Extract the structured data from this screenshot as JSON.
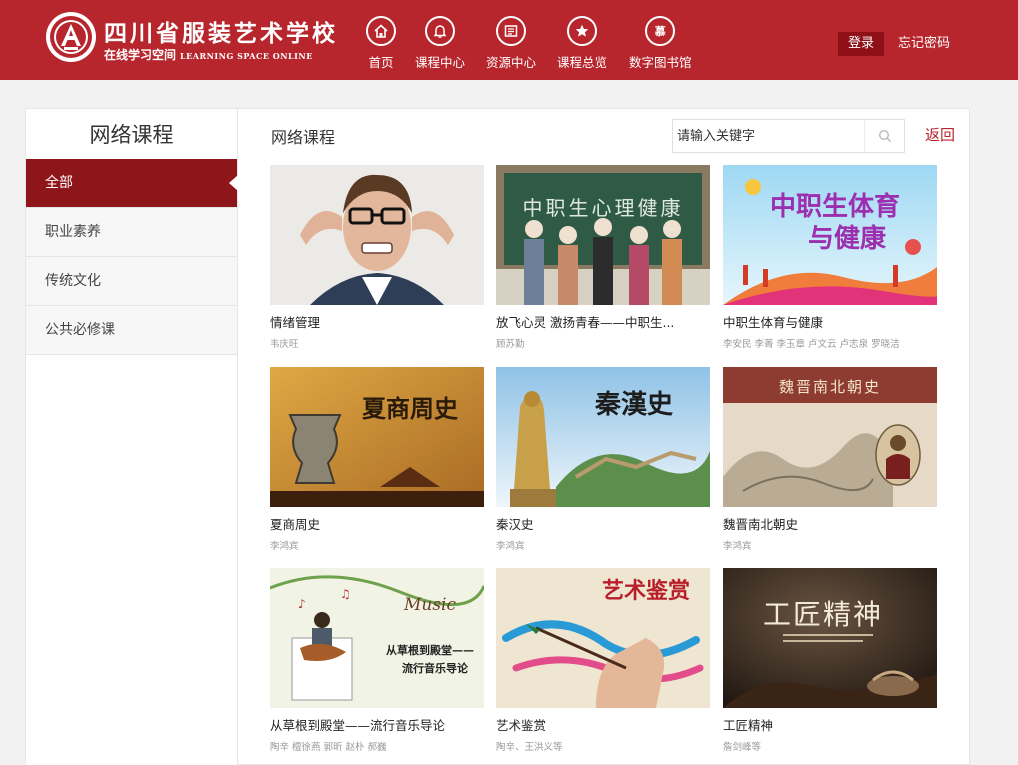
{
  "header": {
    "school_name": "四川省服装艺术学校",
    "subtitle_cn": "在线学习空间",
    "subtitle_en": "LEARNING SPACE ONLINE",
    "nav": [
      {
        "label": "首页",
        "icon": "home-icon"
      },
      {
        "label": "课程中心",
        "icon": "bell-icon"
      },
      {
        "label": "资源中心",
        "icon": "resource-icon"
      },
      {
        "label": "课程总览",
        "icon": "star-icon"
      },
      {
        "label": "数字图书馆",
        "icon": "mooc-icon",
        "glyph": "慕"
      }
    ],
    "login_label": "登录",
    "forgot_label": "忘记密码"
  },
  "sidebar": {
    "title": "网络课程",
    "items": [
      {
        "label": "全部",
        "active": true
      },
      {
        "label": "职业素养",
        "active": false
      },
      {
        "label": "传统文化",
        "active": false
      },
      {
        "label": "公共必修课",
        "active": false
      }
    ]
  },
  "main": {
    "title": "网络课程",
    "search_placeholder": "请输入关键字",
    "back_label": "返回",
    "courses": [
      {
        "title": "情绪管理",
        "author": "韦庆旺"
      },
      {
        "title": "放飞心灵 激扬青春——中职生...",
        "author": "顾苏勤",
        "thumb_text": "中职生心理健康"
      },
      {
        "title": "中职生体育与健康",
        "author": "李安民 李菁 李玉章 卢文云 卢志泉 罗晓洁",
        "thumb_text": [
          "中职生体育",
          "与健康"
        ]
      },
      {
        "title": "夏商周史",
        "author": "李鸿宾",
        "thumb_text": "夏商周史"
      },
      {
        "title": "秦汉史",
        "author": "李鸿宾",
        "thumb_text": "秦漢史"
      },
      {
        "title": "魏晋南北朝史",
        "author": "李鸿宾",
        "thumb_text": "魏晋南北朝史"
      },
      {
        "title": "从草根到殿堂——流行音乐导论",
        "author": "陶辛 檀徐燕 郭昕 赵朴 郝巍",
        "thumb_text": [
          "从草根到殿堂——",
          "流行音乐导论"
        ]
      },
      {
        "title": "艺术鉴赏",
        "author": "陶辛、王洪义等",
        "thumb_text": "艺术鉴赏"
      },
      {
        "title": "工匠精神",
        "author": "詹剑峰等",
        "thumb_text": "工匠精神"
      }
    ]
  },
  "colors": {
    "brand_red": "#b8262d",
    "active_red": "#8e1519"
  }
}
